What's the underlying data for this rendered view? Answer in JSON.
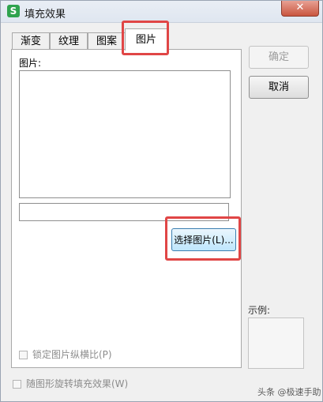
{
  "window": {
    "title": "填充效果",
    "app_icon_letter": "S",
    "close_symbol": "✕"
  },
  "tabs": [
    {
      "label": "渐变",
      "active": false
    },
    {
      "label": "纹理",
      "active": false
    },
    {
      "label": "图案",
      "active": false
    },
    {
      "label": "图片",
      "active": true
    }
  ],
  "picture_panel": {
    "picture_label": "图片:",
    "picture_path_value": "",
    "select_button_label": "选择图片(L)...",
    "lock_aspect_label": "锁定图片纵横比(P)",
    "lock_aspect_checked": false
  },
  "buttons": {
    "ok_label": "确定",
    "cancel_label": "取消"
  },
  "sample": {
    "label": "示例:"
  },
  "rotate_with_shape_label": "随图形旋转填充效果(W)",
  "watermark": "头条 @极速手助",
  "colors": {
    "highlight": "#e04646",
    "app_icon": "#2fa34e",
    "close_button": "#c9553f"
  }
}
